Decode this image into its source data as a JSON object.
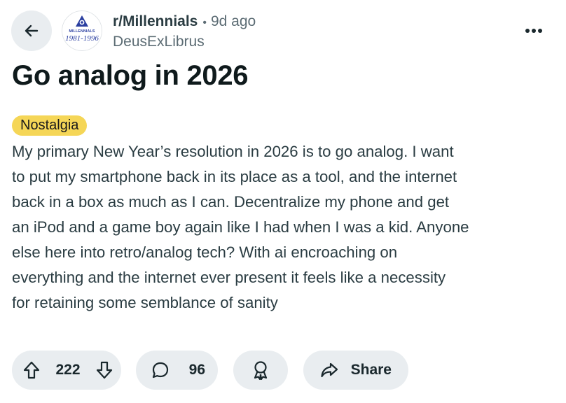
{
  "header": {
    "subreddit": "r/Millennials",
    "separator": "•",
    "time_ago": "9d ago",
    "username": "DeusExLibrus",
    "avatar": {
      "top_text": "MILLENNIALS",
      "bottom_text": "1981-1996",
      "icon": "millennials-logo"
    }
  },
  "post": {
    "title": "Go analog in 2026",
    "flair": "Nostalgia",
    "body_lines": [
      "My primary New Year’s resolution in 2026 is to go analog. I want",
      "to put my smartphone back in its place as a tool, and the internet",
      "back in a box as much as I can. Decentralize my phone and get",
      "an iPod and a game boy again like I had when I was a kid. Anyone",
      "else here into retro/analog tech? With ai encroaching on",
      "everything and the internet ever present it feels like a necessity",
      "for retaining some semblance of sanity"
    ]
  },
  "actions": {
    "vote_count": "222",
    "comment_count": "96",
    "share_label": "Share"
  },
  "icons": {
    "back": "arrow-left-icon",
    "more": "more-horizontal-icon",
    "upvote": "upvote-arrow-icon",
    "downvote": "downvote-arrow-icon",
    "comment": "comment-bubble-icon",
    "award": "award-ribbon-icon",
    "share": "share-arrow-icon"
  },
  "colors": {
    "flair_bg": "#f5d657",
    "pill_bg": "#e9edf0",
    "subreddit_text": "#2a3c42",
    "meta_text": "#5c6c74",
    "avatar_blue": "#2b3fa0"
  }
}
